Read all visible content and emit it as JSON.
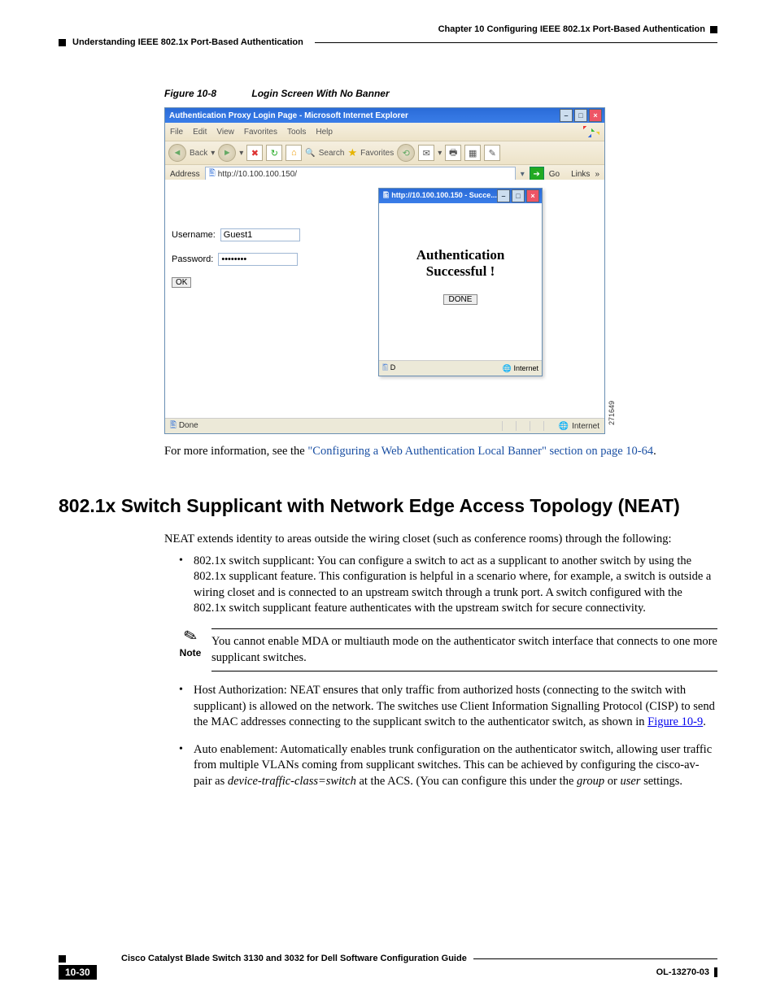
{
  "header": {
    "chapter": "Chapter 10    Configuring IEEE 802.1x Port-Based Authentication",
    "section": "Understanding IEEE 802.1x Port-Based Authentication"
  },
  "figure": {
    "label": "Figure 10-8",
    "title": "Login Screen With No Banner",
    "id_label": "271649"
  },
  "browser": {
    "title": "Authentication Proxy Login Page - Microsoft Internet Explorer",
    "menu": [
      "File",
      "Edit",
      "View",
      "Favorites",
      "Tools",
      "Help"
    ],
    "toolbar": {
      "back": "Back",
      "search": "Search",
      "favorites": "Favorites"
    },
    "address_label": "Address",
    "address_value": "http://10.100.100.150/",
    "go": "Go",
    "links": "Links",
    "login": {
      "username_label": "Username:",
      "username_value": "Guest1",
      "password_label": "Password:",
      "password_value": "••••••••",
      "ok": "OK"
    },
    "popup": {
      "title": "http://10.100.100.150 - Succe...",
      "line1": "Authentication",
      "line2": "Successful !",
      "done": "DONE",
      "status_left": "D",
      "status_right": "Internet"
    },
    "status_left": "Done",
    "status_right": "Internet"
  },
  "para_after_fig_pre": "For more information, see the ",
  "para_after_fig_link": "\"Configuring a Web Authentication Local Banner\" section on page 10-64",
  "para_after_fig_post": ".",
  "heading": "802.1x Switch Supplicant with Network Edge Access Topology (NEAT)",
  "intro": "NEAT extends identity to areas outside the wiring closet (such as conference rooms) through the following:",
  "bullet1": "802.1x switch supplicant: You can configure a switch to act as a supplicant to another switch by using the 802.1x supplicant feature. This configuration is helpful in a scenario where, for example, a switch is outside a wiring closet and is connected to an upstream switch through a trunk port. A switch configured with the 802.1x switch supplicant feature authenticates with the upstream switch for secure connectivity.",
  "note_label": "Note",
  "note_text": "You cannot enable MDA or multiauth mode on the authenticator switch interface that connects to one more supplicant switches.",
  "bullet2_pre": "Host Authorization: NEAT ensures that only traffic from authorized hosts (connecting to the switch with supplicant) is allowed on the network. The switches use Client Information Signalling Protocol (CISP) to send the MAC addresses connecting to the supplicant switch to the authenticator switch, as shown in ",
  "bullet2_link": "Figure 10-9",
  "bullet2_post": ".",
  "bullet3_a": "Auto enablement: Automatically enables trunk configuration on the authenticator switch, allowing user traffic from multiple VLANs coming from supplicant switches. This can be achieved by configuring the cisco-av-pair as ",
  "bullet3_i1": "device-traffic-class=switch",
  "bullet3_b": " at the ACS. (You can configure this under the ",
  "bullet3_i2": "group",
  "bullet3_c": " or ",
  "bullet3_i3": "user",
  "bullet3_d": " settings.",
  "footer": {
    "book": "Cisco Catalyst Blade Switch 3130 and 3032 for Dell Software Configuration Guide",
    "page": "10-30",
    "doc": "OL-13270-03"
  }
}
